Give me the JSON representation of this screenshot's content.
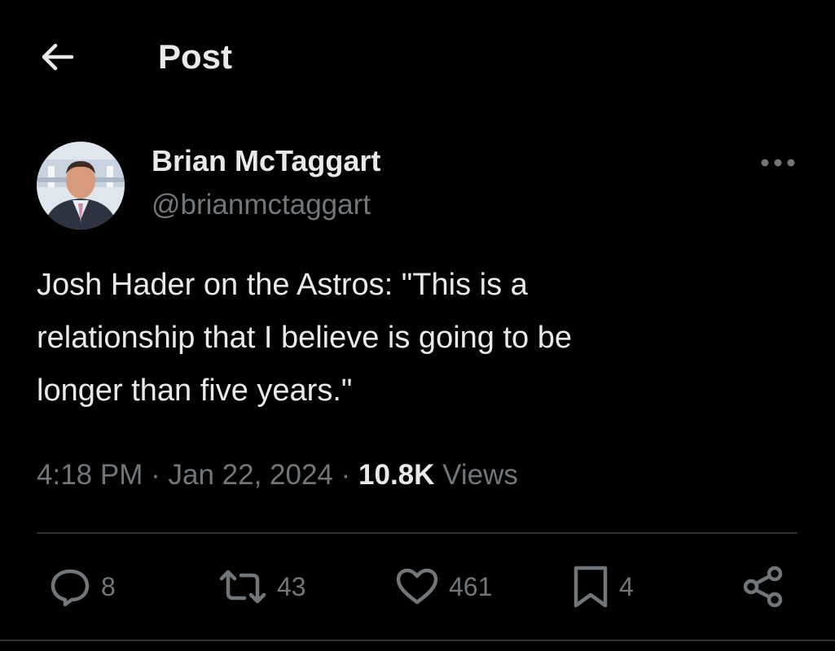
{
  "header": {
    "back_icon": "arrow-left-icon",
    "title": "Post"
  },
  "author": {
    "name": "Brian McTaggart",
    "handle": "@brianmctaggart",
    "avatar_icon": "avatar"
  },
  "tweet": {
    "text": "Josh Hader on the Astros: \"This is a\nrelationship that I believe is going to be\nlonger than five years.\""
  },
  "meta": {
    "time": "4:18 PM",
    "separator": "·",
    "date": "Jan 22, 2024",
    "views_count": "10.8K",
    "views_label": "Views"
  },
  "actions": {
    "reply_count": "8",
    "repost_count": "43",
    "like_count": "461",
    "bookmark_count": "4"
  },
  "colors": {
    "background": "#000000",
    "primary_text": "#e7e9ea",
    "secondary_text": "#71767b",
    "divider": "#2f3336"
  }
}
